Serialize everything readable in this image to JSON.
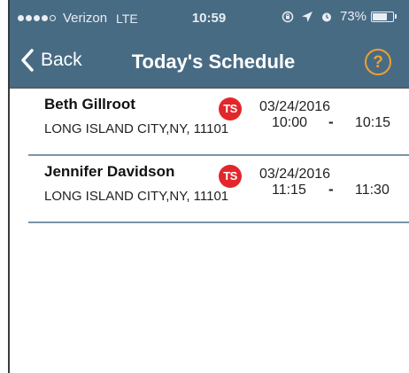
{
  "status_bar": {
    "carrier": "Verizon",
    "network": "LTE",
    "time": "10:59",
    "battery_percent": "73%",
    "battery_level": 0.73,
    "icons": [
      "rotation-lock-icon",
      "location-icon",
      "alarm-icon",
      "battery-icon"
    ]
  },
  "nav": {
    "back_label": "Back",
    "title": "Today's Schedule",
    "help_label": "?"
  },
  "appointments": [
    {
      "name": "Beth Gillroot",
      "address": "LONG ISLAND CITY,NY, 11101",
      "badge": "TS",
      "date": "03/24/2016",
      "start": "10:00",
      "separator": "-",
      "end": "10:15"
    },
    {
      "name": "Jennifer Davidson",
      "address": "LONG ISLAND CITY,NY, 11101",
      "badge": "TS",
      "date": "03/24/2016",
      "start": "11:15",
      "separator": "-",
      "end": "11:30"
    }
  ],
  "colors": {
    "header_bg": "#486b84",
    "accent_help": "#f0a030",
    "badge_red": "#e2262b"
  }
}
